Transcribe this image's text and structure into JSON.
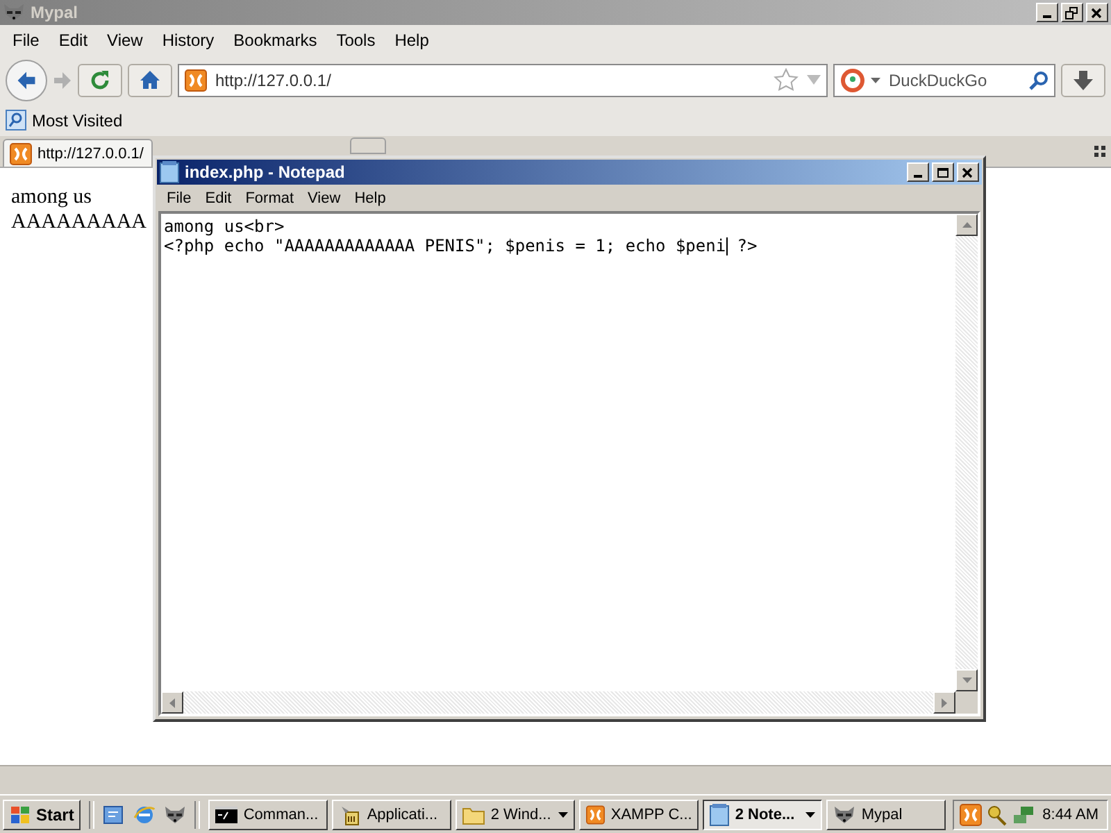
{
  "browser": {
    "title": "Mypal",
    "menu": [
      "File",
      "Edit",
      "View",
      "History",
      "Bookmarks",
      "Tools",
      "Help"
    ],
    "address": {
      "value": "http://127.0.0.1/"
    },
    "search": {
      "placeholder": "DuckDuckGo"
    },
    "bookmarks": [
      "Most Visited"
    ],
    "tabs": [
      {
        "label": "http://127.0.0.1/",
        "selected": true
      }
    ],
    "page": {
      "lines": [
        "among us",
        "AAAAAAAAA"
      ]
    }
  },
  "notepad": {
    "title": "index.php - Notepad",
    "menu": [
      "File",
      "Edit",
      "Format",
      "View",
      "Help"
    ],
    "lines": [
      {
        "before_caret": "among us<br>",
        "caret": false
      },
      {
        "before_caret": "<?php echo \"AAAAAAAAAAAAA PENIS\"; $penis = 1; echo $peni",
        "after_caret": " ?>",
        "caret": true
      }
    ]
  },
  "taskbar": {
    "start": "Start",
    "tasks": [
      {
        "label": "Comman...",
        "kind": "console",
        "group": false,
        "selected": false
      },
      {
        "label": "Applicati...",
        "kind": "installer",
        "group": false,
        "selected": false
      },
      {
        "label": "2 Wind...",
        "kind": "folder",
        "group": true,
        "selected": false
      },
      {
        "label": "XAMPP C...",
        "kind": "xampp",
        "group": false,
        "selected": false
      },
      {
        "label": "2 Note...",
        "kind": "notepad",
        "group": true,
        "selected": true
      },
      {
        "label": "Mypal",
        "kind": "raccoon",
        "group": false,
        "selected": false
      }
    ],
    "clock": "8:44 AM"
  }
}
